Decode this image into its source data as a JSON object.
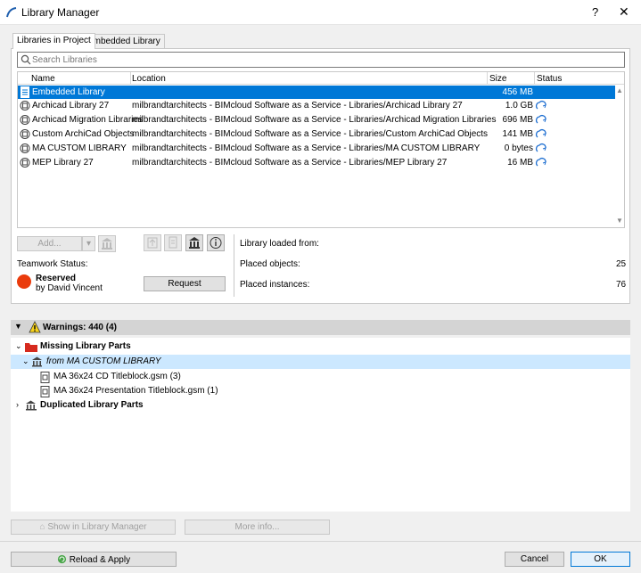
{
  "window": {
    "title": "Library Manager",
    "help_label": "?",
    "close_label": "✕"
  },
  "tabs": [
    {
      "label": "Libraries in Project",
      "active": true
    },
    {
      "label": "Embedded Library",
      "active": false
    }
  ],
  "search": {
    "placeholder": "Search Libraries"
  },
  "table": {
    "columns": [
      "Name",
      "Location",
      "Size",
      "Status"
    ],
    "rows": [
      {
        "name": "Embedded Library",
        "location": "",
        "size": "456 MB",
        "status": "",
        "selected": true,
        "icon": "library-file-icon"
      },
      {
        "name": "Archicad Library 27",
        "location": "milbrandtarchitects - BIMcloud Software as a Service - Libraries/Archicad Library 27",
        "size": "1.0 GB",
        "status": "cloud-sync-icon",
        "icon": "library-cloud-icon"
      },
      {
        "name": "Archicad Migration Libraries",
        "location": "milbrandtarchitects - BIMcloud Software as a Service - Libraries/Archicad Migration Libraries",
        "size": "696 MB",
        "status": "cloud-sync-icon",
        "icon": "library-cloud-icon"
      },
      {
        "name": "Custom ArchiCad Objects",
        "location": "milbrandtarchitects - BIMcloud Software as a Service - Libraries/Custom ArchiCad Objects",
        "size": "141 MB",
        "status": "cloud-sync-icon",
        "icon": "library-cloud-icon"
      },
      {
        "name": "MA CUSTOM LIBRARY",
        "location": "milbrandtarchitects - BIMcloud Software as a Service - Libraries/MA CUSTOM LIBRARY",
        "size": "0 bytes",
        "status": "cloud-sync-icon",
        "icon": "library-cloud-icon"
      },
      {
        "name": "MEP Library 27",
        "location": "milbrandtarchitects - BIMcloud Software as a Service - Libraries/MEP Library 27",
        "size": "16 MB",
        "status": "cloud-sync-icon",
        "icon": "library-cloud-icon"
      }
    ]
  },
  "library_controls": {
    "add_label": "Add...",
    "teamwork_status_label": "Teamwork Status:",
    "reserved_label": "Reserved",
    "reserved_by": "by David Vincent",
    "request_label": "Request"
  },
  "library_info": {
    "loaded_from_label": "Library loaded from:",
    "placed_objects_label": "Placed objects:",
    "placed_objects_value": "25",
    "placed_instances_label": "Placed instances:",
    "placed_instances_value": "76"
  },
  "warnings": {
    "header": "Warnings: 440 (4)",
    "tree": [
      {
        "label": "Missing Library Parts",
        "bold": true,
        "italic": false,
        "level": 0
      },
      {
        "label": "from MA CUSTOM LIBRARY",
        "bold": false,
        "italic": true,
        "level": 1
      },
      {
        "label": "MA 36x24 CD Titleblock.gsm (3)",
        "bold": false,
        "italic": false,
        "level": 2
      },
      {
        "label": "MA 36x24 Presentation Titleblock.gsm (1)",
        "bold": false,
        "italic": false,
        "level": 2
      },
      {
        "label": "Duplicated Library Parts",
        "bold": true,
        "italic": false,
        "level": 0
      }
    ]
  },
  "footer": {
    "show_in_manager_label": "Show in Library Manager",
    "more_info_label": "More info...",
    "reload_apply_label": "Reload & Apply",
    "cancel_label": "Cancel",
    "ok_label": "OK"
  },
  "colors": {
    "selection": "#0078d7",
    "reserved_dot": "#ea3b0c",
    "tree_highlight": "#cce8ff",
    "cloud_icon": "#1f6fd1"
  }
}
